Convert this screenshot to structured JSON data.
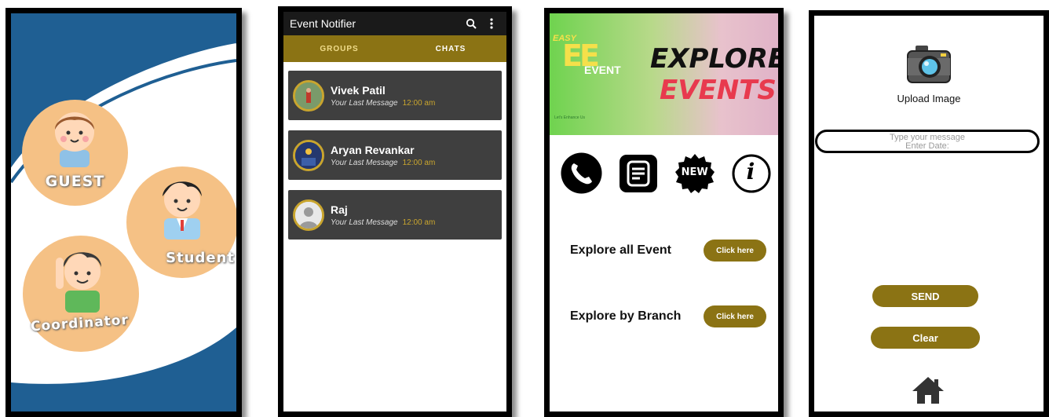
{
  "screen1": {
    "roles": [
      {
        "label": "GUEST"
      },
      {
        "label": "Student"
      },
      {
        "label": "Coordinator"
      }
    ]
  },
  "screen2": {
    "app_title": "Event Notifier",
    "icons": [
      "search-icon",
      "more-vert-icon"
    ],
    "tabs": [
      {
        "label": "GROUPS"
      },
      {
        "label": "CHATS"
      }
    ],
    "chats": [
      {
        "name": "Vivek Patil",
        "last_message": "Your Last Message",
        "time": "12:00 am"
      },
      {
        "name": "Aryan Revankar",
        "last_message": "Your Last Message",
        "time": "12:00 am"
      },
      {
        "name": "Raj",
        "last_message": "Your Last Message",
        "time": "12:00 am"
      }
    ],
    "colors": {
      "appbar": "#1a1a1a",
      "tabs": "#8b7314",
      "row": "#3f3f3f",
      "accent": "#c9a52e"
    }
  },
  "screen3": {
    "logo": {
      "line1": "EASY",
      "mark": "EE",
      "line2": "EVENT",
      "tag": "Let's Enhance Us"
    },
    "banner_title_1": "EXPLORE",
    "banner_title_2": "EVENTS",
    "icons": [
      "phone-icon",
      "notes-icon",
      "new-badge-icon",
      "info-icon"
    ],
    "new_badge": "NEW",
    "info_glyph": "i",
    "rows": [
      {
        "label": "Explore all Event",
        "button": "Click here"
      },
      {
        "label": "Explore by Branch",
        "button": "Click here"
      }
    ]
  },
  "screen4": {
    "upload_label": "Upload Image",
    "message_placeholder": "Type your message",
    "date_placeholder": "Enter Date:",
    "send_label": "SEND",
    "clear_label": "Clear",
    "icons": [
      "camera-icon",
      "home-icon"
    ],
    "colors": {
      "button": "#8b7314"
    }
  }
}
